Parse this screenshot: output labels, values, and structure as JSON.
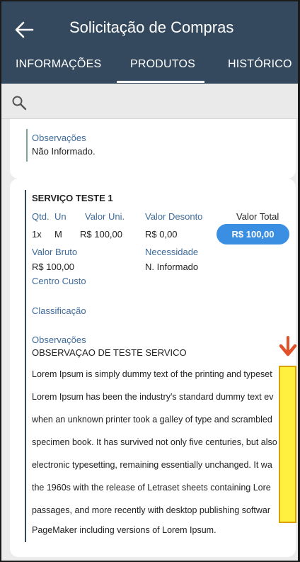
{
  "header": {
    "title": "Solicitação de Compras",
    "tabs": [
      {
        "label": "INFORMAÇÕES"
      },
      {
        "label": "PRODUTOS"
      },
      {
        "label": "HISTÓRICO"
      }
    ],
    "active_tab": "PRODUTOS",
    "back_icon": "arrow-left-icon"
  },
  "search": {
    "icon": "search-icon",
    "placeholder": "",
    "value": ""
  },
  "card_top": {
    "obs_label": "Observações",
    "obs_value": "Não Informado."
  },
  "item": {
    "name": "SERVIÇO TESTE 1",
    "qtd_label": "Qtd.",
    "un_label": "Un",
    "valor_uni_label": "Valor Uni.",
    "valor_desconto_label": "Valor Desonto",
    "valor_total_label": "Valor Total",
    "qtd": "1x",
    "un": "M",
    "valor_uni": "R$ 100,00",
    "valor_desconto": "R$ 0,00",
    "valor_total": "R$ 100,00",
    "valor_bruto_label": "Valor Bruto",
    "valor_bruto": "R$ 100,00",
    "necessidade_label": "Necessidade",
    "necessidade": "N. Informado",
    "centro_custo_label": "Centro Custo",
    "classificacao_label": "Classificação",
    "obs_label": "Observações",
    "obs_value": "OBSERVAÇAO DE TESTE SERVICO",
    "lorem_lines": [
      "Lorem Ipsum is simply dummy text of the printing and typeset",
      "Lorem Ipsum has been the industry's standard dummy text ev",
      "when an unknown printer took a galley of type and scrambled",
      "specimen book. It has survived not only five centuries, but also",
      "electronic typesetting, remaining essentially unchanged. It wa",
      "the 1960s with the release of Letraset sheets containing Lore",
      "passages, and more recently with desktop publishing softwar",
      "PageMaker including versions of Lorem Ipsum."
    ]
  },
  "annotation": {
    "arrow_icon": "arrow-down-icon",
    "highlight_color": "#ffeb00",
    "arrow_color": "#e2522a"
  },
  "colors": {
    "header": "#34495e",
    "label": "#3d6b9b",
    "button": "#3b8fe3"
  }
}
